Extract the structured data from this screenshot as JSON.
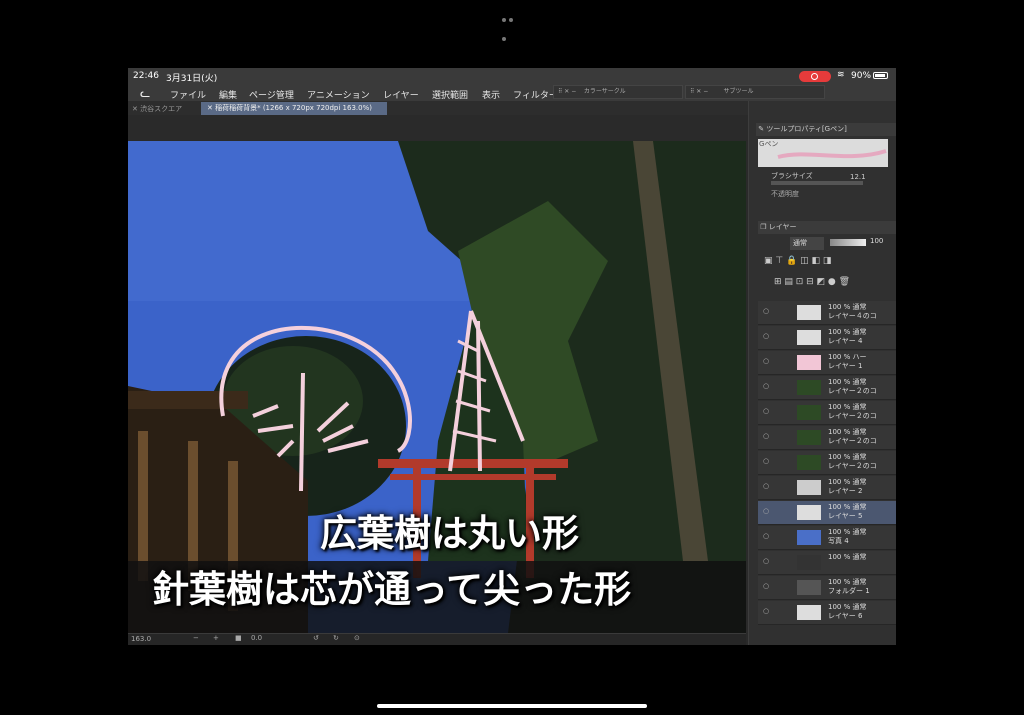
{
  "status_bar": {
    "time": "22:46",
    "date": "3月31日(火)",
    "battery": "90%"
  },
  "menu": {
    "items": [
      "ファイル",
      "編集",
      "ページ管理",
      "アニメーション",
      "レイヤー",
      "選択範囲",
      "表示",
      "フィルター"
    ],
    "color_circle_panel": "カラーサークル",
    "sub_tool_panel": "サブツール"
  },
  "tabs": {
    "tab1": "渋谷スクエア",
    "tab2": "稲荷稲荷背景* (1266 x 720px 720dpi 163.0%)"
  },
  "canvas": {
    "caption_line1": "広葉樹は丸い形",
    "caption_line2": "針葉樹は芯が通って尖った形",
    "zoom": "163.0",
    "rotation": "0.0"
  },
  "tool_property": {
    "header": "ツールプロパティ[Gペン]",
    "brush_name": "Gペン",
    "brush_size_label": "ブラシサイズ",
    "brush_size_value": "12.1",
    "opacity_label": "不透明度"
  },
  "layers": {
    "header": "レイヤー",
    "blend_mode": "通常",
    "opacity": "100",
    "items": [
      {
        "line1": "100 % 通常",
        "line2": "レイヤー４のコ"
      },
      {
        "line1": "100 % 通常",
        "line2": "レイヤー 4"
      },
      {
        "line1": "100 % ハー",
        "line2": "レイヤー 1"
      },
      {
        "line1": "100 % 通常",
        "line2": "レイヤー２のコ"
      },
      {
        "line1": "100 % 通常",
        "line2": "レイヤー２のコ"
      },
      {
        "line1": "100 % 通常",
        "line2": "レイヤー２のコ"
      },
      {
        "line1": "100 % 通常",
        "line2": "レイヤー２のコ"
      },
      {
        "line1": "100 % 通常",
        "line2": "レイヤー 2"
      },
      {
        "line1": "100 % 通常",
        "line2": "レイヤー 5"
      },
      {
        "line1": "100 % 通常",
        "line2": "写真 4"
      },
      {
        "line1": "100 % 通常",
        "line2": ""
      },
      {
        "line1": "100 % 通常",
        "line2": "フォルダー 1"
      },
      {
        "line1": "100 % 通常",
        "line2": "レイヤー 6"
      }
    ]
  },
  "colors": {
    "sky": "#3b63c9",
    "selection": "#4b5770",
    "record": "#e63b3b"
  }
}
